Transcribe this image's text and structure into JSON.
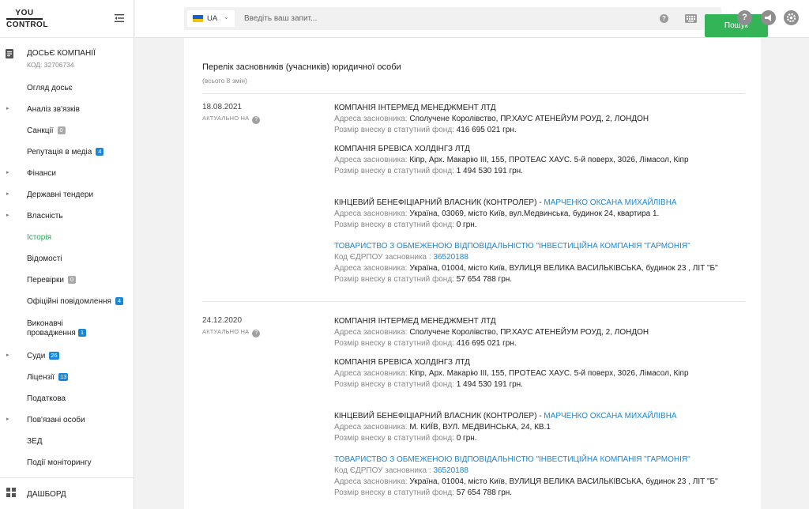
{
  "logo": {
    "line1": "YOU",
    "line2": "CONTROL"
  },
  "dossier": {
    "title": "ДОСЬЄ КОМПАНІЇ",
    "code": "КОД: 32706734"
  },
  "nav": [
    {
      "label": "Огляд досьє",
      "arrow": false
    },
    {
      "label": "Аналіз зв'язків",
      "arrow": true
    },
    {
      "label": "Санкції",
      "arrow": false,
      "badge": "0",
      "badge_color": "grey"
    },
    {
      "label": "Репутація в медіа",
      "arrow": false,
      "badge": "4",
      "badge_color": "blue"
    },
    {
      "label": "Фінанси",
      "arrow": true
    },
    {
      "label": "Державні тендери",
      "arrow": true
    },
    {
      "label": "Власність",
      "arrow": true
    },
    {
      "label": "Історія",
      "arrow": false,
      "active": true
    },
    {
      "label": "Відомості",
      "arrow": false
    },
    {
      "label": "Перевірки",
      "arrow": false,
      "badge": "0",
      "badge_color": "grey"
    },
    {
      "label": "Офіційні повідомлення",
      "arrow": false,
      "badge": "4",
      "badge_color": "blue"
    },
    {
      "label": "Виконавчі провадження",
      "arrow": false,
      "badge": "1",
      "badge_color": "blue",
      "multiline": true
    },
    {
      "label": "Суди",
      "arrow": true,
      "badge": "26",
      "badge_color": "blue"
    },
    {
      "label": "Ліцензії",
      "arrow": false,
      "badge": "13",
      "badge_color": "blue"
    },
    {
      "label": "Податкова",
      "arrow": false
    },
    {
      "label": "Пов'язані особи",
      "arrow": true
    },
    {
      "label": "ЗЕД",
      "arrow": false
    },
    {
      "label": "Події моніторингу",
      "arrow": false
    }
  ],
  "dashboard": {
    "label": "ДАШБОРД"
  },
  "search": {
    "lang": "UA",
    "placeholder": "Введіть ваш запит...",
    "button": "Пошук"
  },
  "top_icons": {
    "help": "?",
    "announce": "announce-icon",
    "settings": "gear-icon"
  },
  "colors": {
    "accent": "#33b456",
    "link": "#1a86d6",
    "badge_grey": "#a9a9a9"
  },
  "card": {
    "title": "Перелік засновників (учасників) юридичної особи",
    "subtitle": "(всього 8 змін)",
    "actual_label": "АКТУАЛЬНО НА",
    "records": [
      {
        "date": "18.08.2021",
        "founders": [
          {
            "name": "КОМПАНІЯ ІНТЕРМЕД МЕНЕДЖМЕНТ ЛТД",
            "address_label": "Адреса засновника:",
            "address": "Сполучене Королівство, ПР.ХАУС АТЕНЕЙУМ РОУД, 2, ЛОНДОН",
            "capital_label": "Розмір внеску в статутний фонд:",
            "capital": "416 695 021 грн."
          },
          {
            "name": "КОМПАНІЯ БРЕВІСА ХОЛДІНГЗ ЛТД",
            "address_label": "Адреса засновника:",
            "address": "Кіпр, Арх. Макарію III, 155, ПРОТЕАС ХАУС. 5-й поверх, 3026, Лімасол, Кіпр",
            "capital_label": "Розмір внеску в статутний фонд:",
            "capital": "1 494 530 191 грн."
          },
          {
            "name": "КІНЦЕВИЙ БЕНЕФІЦІАРНИЙ ВЛАСНИК (КОНТРОЛЕР) - ",
            "name_link": "МАРЧЕНКО ОКСАНА МИХАЙЛІВНА",
            "address_label": "Адреса засновника:",
            "address": "Україна, 03069, місто Київ, вул.Медвинська, будинок 24, квартира 1.",
            "capital_label": "Розмір внеску в статутний фонд:",
            "capital": "0 грн."
          },
          {
            "name_link": "ТОВАРИСТВО З ОБМЕЖЕНОЮ ВІДПОВІДАЛЬНІСТЮ \"ІНВЕСТИЦІЙНА КОМПАНІЯ \"ГАРМОНІЯ\"",
            "edrpou_label": "Код ЄДРПОУ засновника :",
            "edrpou": "36520188",
            "address_label": "Адреса засновника:",
            "address": "Україна, 01004, місто Київ, ВУЛИЦЯ ВЕЛИКА ВАСИЛЬКІВСЬКА, будинок 23 , ЛІТ \"Б\"",
            "capital_label": "Розмір внеску в статутний фонд:",
            "capital": "57 654 788 грн."
          }
        ]
      },
      {
        "date": "24.12.2020",
        "founders": [
          {
            "name": "КОМПАНІЯ ІНТЕРМЕД МЕНЕДЖМЕНТ ЛТД",
            "address_label": "Адреса засновника:",
            "address": "Сполучене Королівство, ПР.ХАУС АТЕНЕЙУМ РОУД, 2, ЛОНДОН",
            "capital_label": "Розмір внеску в статутний фонд:",
            "capital": "416 695 021 грн."
          },
          {
            "name": "КОМПАНІЯ БРЕВІСА ХОЛДІНГЗ ЛТД",
            "address_label": "Адреса засновника:",
            "address": "Кіпр, Арх. Макарію III, 155, ПРОТЕАС ХАУС. 5-й поверх, 3026, Лімасол, Кіпр",
            "capital_label": "Розмір внеску в статутний фонд:",
            "capital": "1 494 530 191 грн."
          },
          {
            "name": "КІНЦЕВИЙ БЕНЕФІЦІАРНИЙ ВЛАСНИК (КОНТРОЛЕР) - ",
            "name_link": "МАРЧЕНКО ОКСАНА МИХАЙЛІВНА",
            "address_label": "Адреса засновника:",
            "address": "М. КИЇВ, ВУЛ. МЕДВИНСЬКА, 24, КВ.1",
            "capital_label": "Розмір внеску в статутний фонд:",
            "capital": "0 грн."
          },
          {
            "name_link": "ТОВАРИСТВО З ОБМЕЖЕНОЮ ВІДПОВІДАЛЬНІСТЮ \"ІНВЕСТИЦІЙНА КОМПАНІЯ \"ГАРМОНІЯ\"",
            "edrpou_label": "Код ЄДРПОУ засновника :",
            "edrpou": "36520188",
            "address_label": "Адреса засновника:",
            "address": "Україна, 01004, місто Київ, ВУЛИЦЯ ВЕЛИКА ВАСИЛЬКІВСЬКА, будинок 23 , ЛІТ \"Б\"",
            "capital_label": "Розмір внеску в статутний фонд:",
            "capital": "57 654 788 грн."
          }
        ]
      }
    ]
  }
}
